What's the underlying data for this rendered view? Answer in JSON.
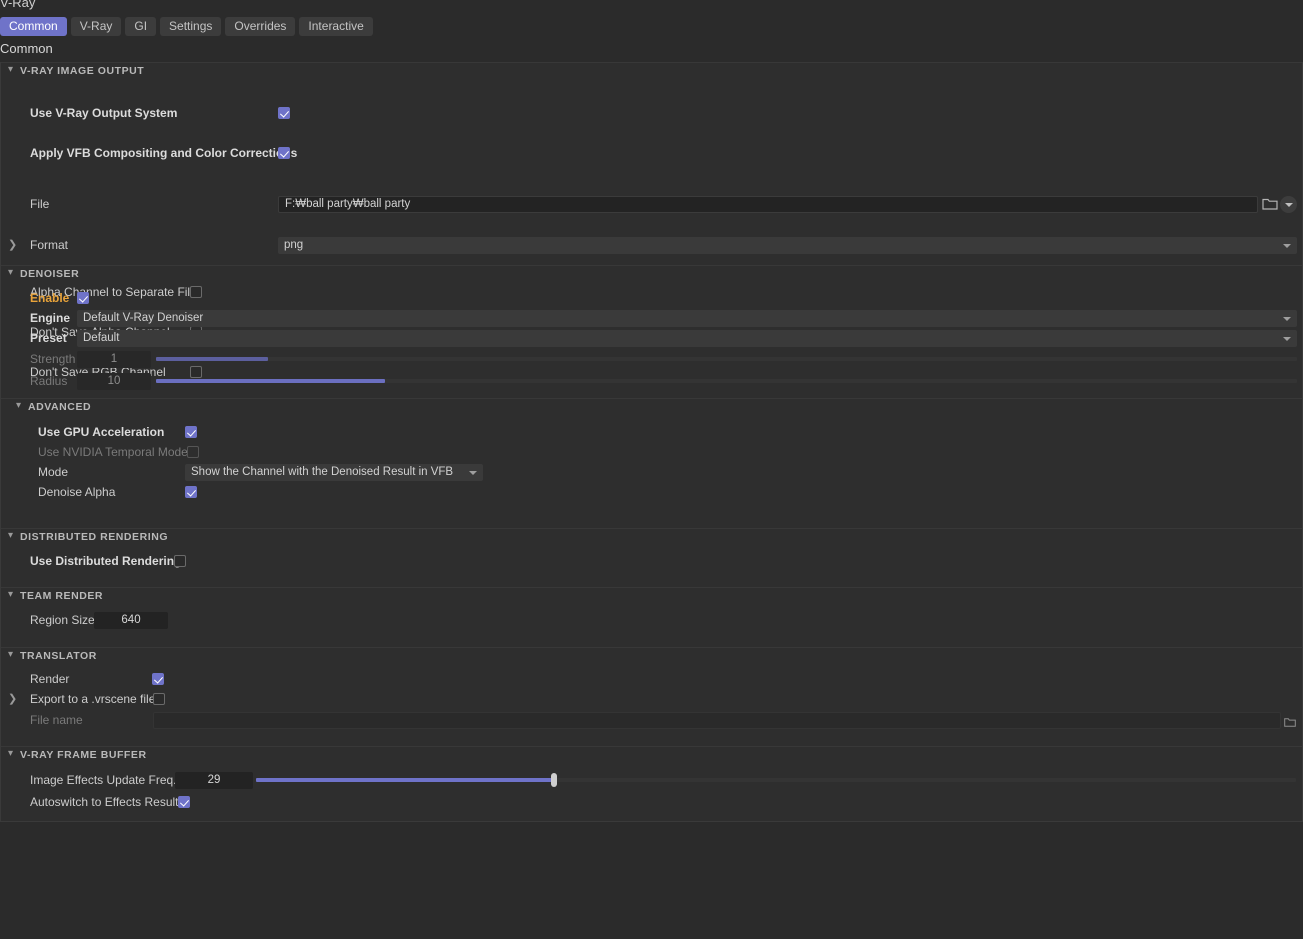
{
  "app": {
    "title": "V-Ray",
    "panel_title": "Common"
  },
  "tabs": [
    {
      "label": "Common",
      "active": true
    },
    {
      "label": "V-Ray",
      "active": false
    },
    {
      "label": "GI",
      "active": false
    },
    {
      "label": "Settings",
      "active": false
    },
    {
      "label": "Overrides",
      "active": false
    },
    {
      "label": "Interactive",
      "active": false
    }
  ],
  "colors": {
    "accent": "#6f73c9",
    "modified": "#e8a33a",
    "panel_bg": "#2e2e2e",
    "window_bg": "#2b2b2b"
  },
  "sections": {
    "image_output": {
      "title": "V-RAY IMAGE OUTPUT",
      "use_output_system_label": "Use V-Ray Output System",
      "use_output_system_value": true,
      "apply_vfb_label": "Apply VFB Compositing and Color Corrections",
      "apply_vfb_value": true,
      "file_label": "File",
      "file_value": "F:₩ball party₩ball party",
      "format_label": "Format",
      "format_value": "png",
      "alpha_separate_label": "Alpha Channel to Separate File",
      "alpha_separate_value": false,
      "no_alpha_label": "Don't Save Alpha Channel",
      "no_alpha_value": false,
      "no_rgb_label": "Don't Save RGB Channel",
      "no_rgb_value": false
    },
    "denoiser": {
      "title": "DENOISER",
      "enable_label": "Enable",
      "enable_value": true,
      "engine_label": "Engine",
      "engine_value": "Default V-Ray Denoiser",
      "preset_label": "Preset",
      "preset_value": "Default",
      "strength_label": "Strength",
      "strength_value": "1",
      "strength_fill_pct": 9.8,
      "radius_label": "Radius",
      "radius_value": "10",
      "radius_fill_pct": 20.1
    },
    "advanced": {
      "title": "ADVANCED",
      "gpu_label": "Use GPU Acceleration",
      "gpu_value": true,
      "temporal_label": "Use NVIDIA Temporal Mode",
      "temporal_value": false,
      "mode_label": "Mode",
      "mode_value": "Show the Channel with the Denoised Result in VFB",
      "denoise_alpha_label": "Denoise Alpha",
      "denoise_alpha_value": true
    },
    "distributed": {
      "title": "DISTRIBUTED RENDERING",
      "use_dr_label": "Use Distributed Rendering",
      "use_dr_value": false
    },
    "team_render": {
      "title": "TEAM RENDER",
      "region_size_label": "Region Size",
      "region_size_value": "640"
    },
    "translator": {
      "title": "TRANSLATOR",
      "render_label": "Render",
      "render_value": true,
      "export_label": "Export to a .vrscene file",
      "export_value": false,
      "file_name_label": "File name",
      "file_name_value": ""
    },
    "frame_buffer": {
      "title": "V-RAY FRAME BUFFER",
      "update_freq_label": "Image Effects Update Freq.",
      "update_freq_value": "29",
      "update_freq_fill_pct": 28.7,
      "autoswitch_label": "Autoswitch to Effects Result",
      "autoswitch_value": true
    }
  }
}
